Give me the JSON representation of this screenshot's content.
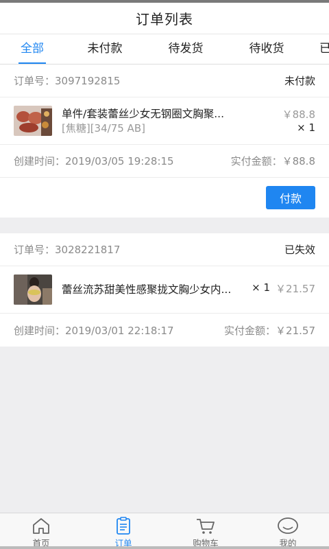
{
  "header": {
    "title": "订单列表"
  },
  "tabs": [
    {
      "label": "全部",
      "active": true
    },
    {
      "label": "未付款"
    },
    {
      "label": "待发货"
    },
    {
      "label": "待收货"
    },
    {
      "label": "已完成"
    }
  ],
  "orders": [
    {
      "order_no_label": "订单号：3097192815",
      "status": "未付款",
      "item": {
        "name": "单件/套装蕾丝少女无钢圈文胸聚...",
        "spec": "[焦糖][34/75 AB]",
        "price": "￥88.8",
        "qty": "× 1"
      },
      "created_label": "创建时间：2019/03/05 19:28:15",
      "paid_label": "实付金额：￥88.8",
      "action": "付款"
    },
    {
      "order_no_label": "订单号：3028221817",
      "status": "已失效",
      "item": {
        "name": "蕾丝流苏甜美性感聚拢文胸少女内...",
        "qty": "× 1",
        "price": "￥21.57"
      },
      "created_label": "创建时间：2019/03/01 22:18:17",
      "paid_label": "实付金额：￥21.57"
    }
  ],
  "tabbar": [
    {
      "label": "首页",
      "icon": "home-icon"
    },
    {
      "label": "订单",
      "icon": "clipboard-icon",
      "active": true
    },
    {
      "label": "购物车",
      "icon": "cart-icon"
    },
    {
      "label": "我的",
      "icon": "profile-icon"
    }
  ],
  "colors": {
    "accent": "#1f86f1",
    "background": "#eeeef0"
  }
}
